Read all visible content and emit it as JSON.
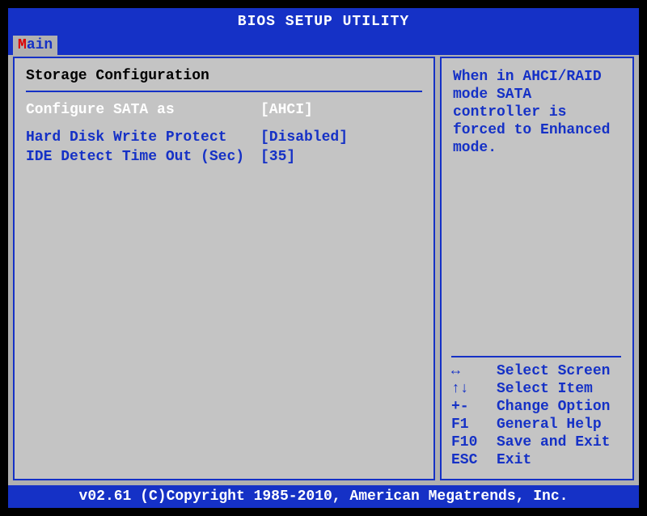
{
  "header": {
    "title": "BIOS SETUP UTILITY"
  },
  "tabs": {
    "main_hotkey": "M",
    "main_rest": "ain"
  },
  "main": {
    "section_title": "Storage Configuration",
    "rows": [
      {
        "label": "Configure SATA as",
        "value": "[AHCI]",
        "selected": true
      },
      {
        "label": "Hard Disk Write Protect",
        "value": "[Disabled]",
        "selected": false
      },
      {
        "label": "IDE Detect Time Out (Sec)",
        "value": "[35]",
        "selected": false
      }
    ]
  },
  "help": {
    "text": "When in AHCI/RAID mode SATA controller is forced to Enhanced mode."
  },
  "legend": [
    {
      "key": "↔",
      "action": "Select Screen"
    },
    {
      "key": "↑↓",
      "action": "Select Item"
    },
    {
      "key": "+-",
      "action": "Change Option"
    },
    {
      "key": "F1",
      "action": "General Help"
    },
    {
      "key": "F10",
      "action": "Save and Exit"
    },
    {
      "key": "ESC",
      "action": "Exit"
    }
  ],
  "footer": {
    "text": "v02.61 (C)Copyright 1985-2010, American Megatrends, Inc."
  }
}
